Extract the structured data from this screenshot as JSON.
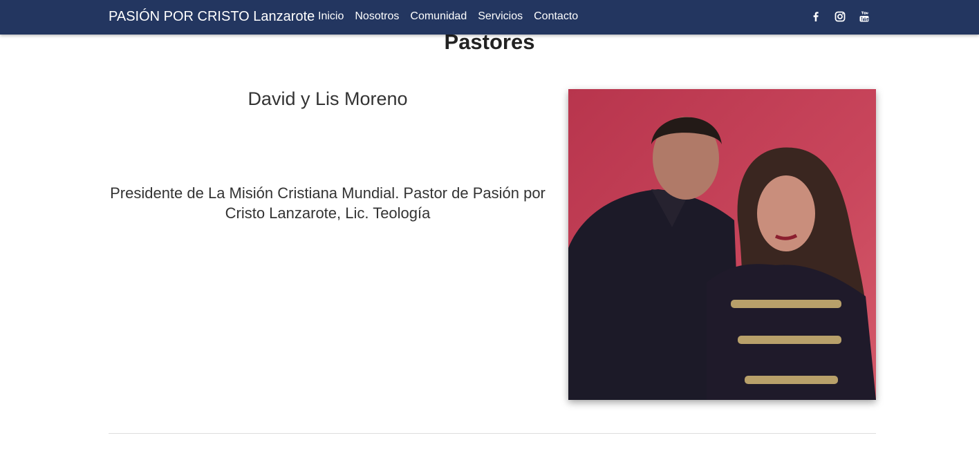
{
  "navbar": {
    "brand": "PASIÓN POR CRISTO Lanzarote",
    "links": [
      {
        "label": "Inicio"
      },
      {
        "label": "Nosotros"
      },
      {
        "label": "Comunidad"
      },
      {
        "label": "Servicios"
      },
      {
        "label": "Contacto"
      }
    ],
    "social": [
      "facebook-icon",
      "instagram-icon",
      "youtube-icon"
    ],
    "background": "#233660"
  },
  "section": {
    "title": "Pastores"
  },
  "pastor": {
    "name": "David y Lis Moreno",
    "description": "Presidente de La Misión Cristiana Mundial. Pastor de Pasión por Cristo Lanzarote, Lic. Teología"
  }
}
